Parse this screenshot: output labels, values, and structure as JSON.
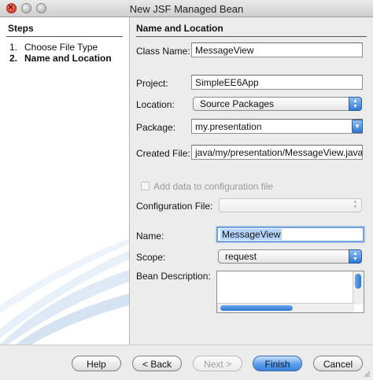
{
  "window": {
    "title": "New JSF Managed Bean"
  },
  "steps": {
    "heading": "Steps",
    "items": [
      {
        "num": "1.",
        "label": "Choose File Type"
      },
      {
        "num": "2.",
        "label": "Name and Location"
      }
    ]
  },
  "form": {
    "heading": "Name and Location",
    "class_name_label": "Class Name:",
    "class_name_value": "MessageView",
    "project_label": "Project:",
    "project_value": "SimpleEE6App",
    "location_label": "Location:",
    "location_value": "Source Packages",
    "package_label": "Package:",
    "package_value": "my.presentation",
    "created_file_label": "Created File:",
    "created_file_value": "java/my/presentation/MessageView.java",
    "add_config_label": "Add data to configuration file",
    "add_config_checked": false,
    "config_file_label": "Configuration File:",
    "config_file_value": "",
    "name_label": "Name:",
    "name_value": "MessageView",
    "scope_label": "Scope:",
    "scope_value": "request",
    "bean_desc_label": "Bean Description:",
    "bean_desc_value": ""
  },
  "buttons": {
    "help": "Help",
    "back": "< Back",
    "next": "Next >",
    "finish": "Finish",
    "cancel": "Cancel"
  },
  "colors": {
    "accent_blue": "#3d85dc",
    "focus_ring": "#6fa2df"
  }
}
